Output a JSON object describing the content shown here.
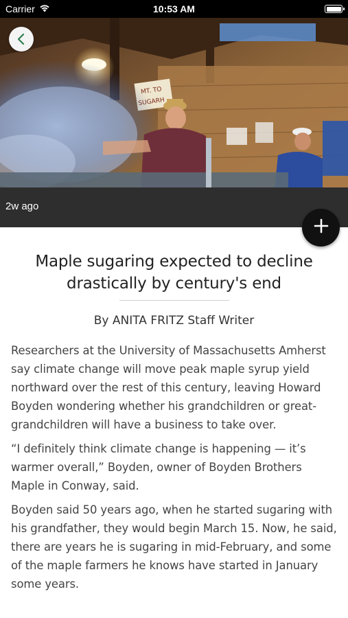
{
  "status_bar": {
    "carrier": "Carrier",
    "time": "10:53 AM"
  },
  "article": {
    "timestamp": "2w ago",
    "headline": "Maple sugaring expected to decline drastically by century's end",
    "byline": "By ANITA FRITZ  Staff Writer",
    "hero_sign_text": "MT. TOBY SUGARHOUSE",
    "paragraphs": [
      "Researchers at the University of Massachusetts Amherst say climate change will move peak maple syrup yield northward over the rest of this century, leaving Howard Boyden wondering whether his grandchildren or great-grandchildren will have a business to take over.",
      "“I definitely think climate change is happening — it’s warmer overall,” Boyden, owner of Boyden Brothers Maple in Conway, said.",
      "Boyden said 50 years ago, when he started sugaring with his grandfather, they would begin March 15. Now, he said, there are years he is sugaring in mid-February, and some of the maple farmers he knows have started in January some years."
    ]
  },
  "icons": {
    "back": "chevron-left-icon",
    "add": "plus-icon",
    "wifi": "wifi-icon",
    "battery": "battery-icon"
  },
  "colors": {
    "accent_green": "#2e7d4f",
    "fab_background": "#111111",
    "status_bar": "#000000"
  }
}
